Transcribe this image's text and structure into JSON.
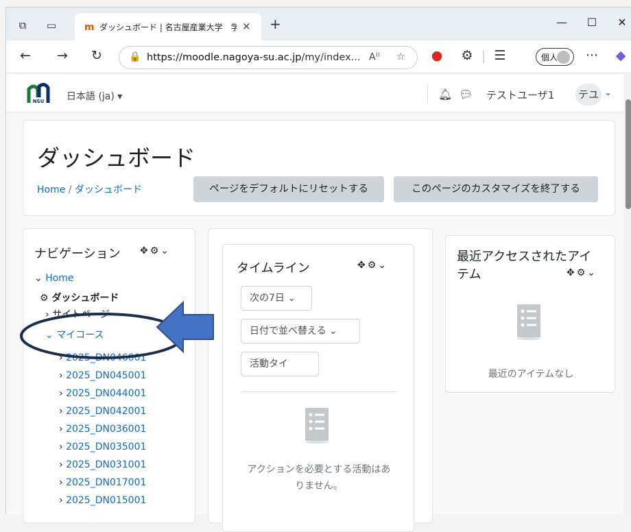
{
  "browser": {
    "tab_title": "ダッシュボード | 名古屋産業大学　学",
    "tab_close": "×",
    "new_tab": "+",
    "url_host": "https://moodle.nagoya-su.ac.jp",
    "url_path": "/my/index...",
    "read_aloud": "A",
    "profile_label": "個人",
    "more": "···"
  },
  "moodle": {
    "lang": "日本語 (ja) ▾",
    "user_name": "テストユーザ1",
    "user_initials": "テユ",
    "page_title": "ダッシュボード",
    "breadcrumb": {
      "home": "Home",
      "sep": "/",
      "current": "ダッシュボード"
    },
    "reset_button": "ページをデフォルトにリセットする",
    "stop_customize_button": "このページのカスタマイズを終了する"
  },
  "navigation": {
    "title": "ナビゲーション",
    "home": "Home",
    "dashboard": "ダッシュボード",
    "site_pages": "サイトページ",
    "my_courses": "マイコース",
    "courses": [
      "2025_DN046001",
      "2025_DN045001",
      "2025_DN044001",
      "2025_DN042001",
      "2025_DN036001",
      "2025_DN035001",
      "2025_DN031001",
      "2025_DN017001",
      "2025_DN015001"
    ]
  },
  "timeline": {
    "title": "タイムライン",
    "range_select": "次の7日",
    "sort_select": "日付で並べ替える",
    "search_placeholder": "活動タイ",
    "empty_line1": "アクションを必要とする活動はあ",
    "empty_line2": "りません。"
  },
  "recent": {
    "title_line1": "最近アクセスされたアイ",
    "title_line2": "テム",
    "empty": "最近のアイテムなし"
  },
  "annotation": {
    "ellipse_color": "#1b2d4f",
    "arrow_color": "#4472c4"
  }
}
